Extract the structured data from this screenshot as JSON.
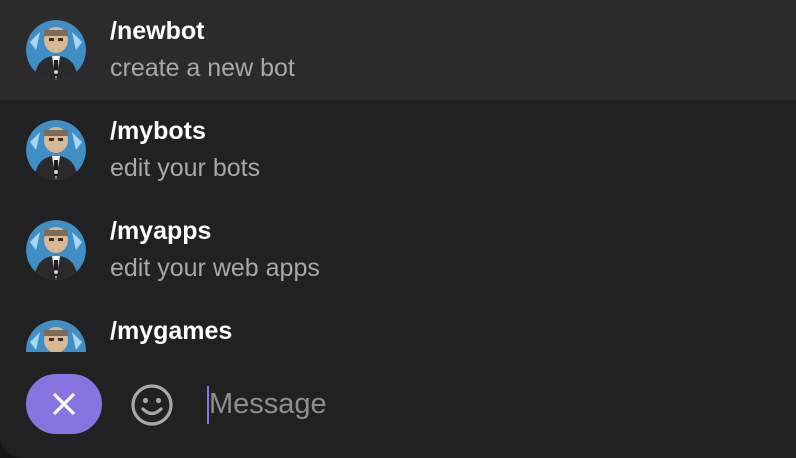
{
  "commands": [
    {
      "name": "/newbot",
      "description": "create a new bot",
      "selected": true
    },
    {
      "name": "/mybots",
      "description": "edit your bots",
      "selected": false
    },
    {
      "name": "/myapps",
      "description": "edit your web apps",
      "selected": false
    },
    {
      "name": "/mygames",
      "description": "",
      "selected": false
    }
  ],
  "composer": {
    "placeholder": "Message",
    "cancel_icon": "close-icon",
    "emoji_icon": "smile-icon"
  },
  "colors": {
    "accent": "#8774e1",
    "panel": "#212121",
    "selected_row": "#2b2b2b",
    "primary_text": "#ffffff",
    "secondary_text": "#a8a8a8"
  }
}
